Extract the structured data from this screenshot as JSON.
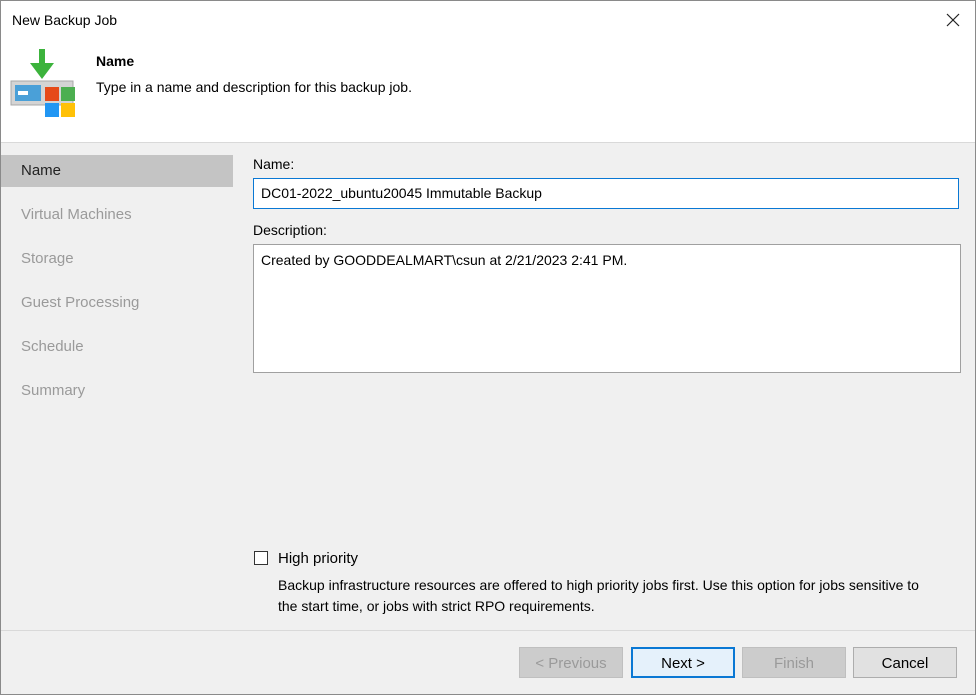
{
  "window": {
    "title": "New Backup Job",
    "close_icon": "close-icon"
  },
  "header": {
    "title": "Name",
    "subtitle": "Type in a name and description for this backup job.",
    "icon": "backup-job-icon"
  },
  "sidebar": {
    "items": [
      {
        "label": "Name",
        "active": true
      },
      {
        "label": "Virtual Machines",
        "active": false
      },
      {
        "label": "Storage",
        "active": false
      },
      {
        "label": "Guest Processing",
        "active": false
      },
      {
        "label": "Schedule",
        "active": false
      },
      {
        "label": "Summary",
        "active": false
      }
    ]
  },
  "form": {
    "name_label": "Name:",
    "name_value": "DC01-2022_ubuntu20045 Immutable Backup",
    "description_label": "Description:",
    "description_value": "Created by GOODDEALMART\\csun at 2/21/2023 2:41 PM.",
    "high_priority_label": "High priority",
    "high_priority_checked": false,
    "high_priority_description": "Backup infrastructure resources are offered to high priority jobs first. Use this option for jobs sensitive to the start time, or jobs with strict RPO requirements."
  },
  "footer": {
    "previous_label": "< Previous",
    "next_label": "Next >",
    "finish_label": "Finish",
    "cancel_label": "Cancel"
  },
  "colors": {
    "accent": "#0a78d4",
    "sidebar_active": "#c4c4c4",
    "disabled_text": "#9a9a9a",
    "green_arrow": "#3cb33c"
  }
}
